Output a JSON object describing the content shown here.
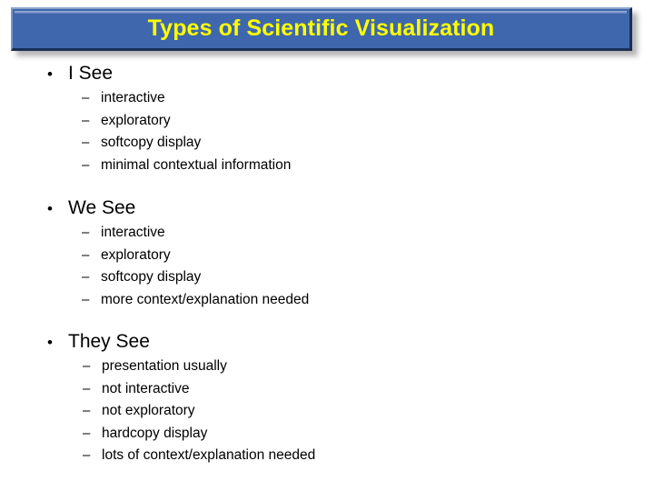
{
  "slide": {
    "title": "Types of Scientific Visualization",
    "title_color": "#ffff00",
    "banner_color": "#3f67ad",
    "background_color": "#ffffff",
    "text_color": "#000000",
    "bullet_marker": "•",
    "dash_marker": "–",
    "groups": [
      {
        "heading": "I See",
        "items": [
          "interactive",
          "exploratory",
          "softcopy display",
          "minimal contextual information"
        ]
      },
      {
        "heading": "We See",
        "items": [
          "interactive",
          "exploratory",
          "softcopy display",
          "more context/explanation needed"
        ]
      },
      {
        "heading": "They See",
        "items": [
          "presentation usually",
          "not interactive",
          "not exploratory",
          "hardcopy display",
          "lots of context/explanation needed"
        ]
      }
    ]
  }
}
